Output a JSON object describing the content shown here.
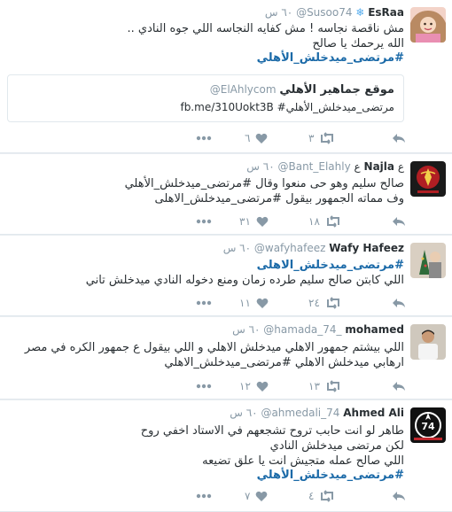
{
  "tweets": [
    {
      "name": "EsRaa",
      "handle": "@Susoo74",
      "time": "٦٠ س",
      "lines": [
        "مش ناقصة نجاسه ! مش كفايه النجاسه اللي جوه النادي ..",
        "الله يرحمك يا صالح"
      ],
      "hashtag": "#مرتضى_ميدخلش_الأهلي",
      "card": {
        "title": "موقع جماهير الأهلي",
        "handle": "@ElAhlycom",
        "text": "fb.me/310Uokt3B #مرتضى_ميدخلش_الأهلي"
      },
      "retweets": "٣",
      "likes": "٦"
    },
    {
      "name": "Najla",
      "handle": "@Bant_Elahly",
      "time": "٦٠ س",
      "lines": [
        "صالح سليم وهو حى منعوا وقال #مرتضى_ميدخلش_الأهلي",
        "وف مماته الجمهور بيقول #مرتضى_ميدخلش_الاهلى"
      ],
      "retweets": "١٨",
      "likes": "٣١"
    },
    {
      "name": "Wafy Hafeez",
      "handle": "@wafyhafeez",
      "time": "٦٠ س",
      "lines": [
        "#مرتضى_ميدخلش_الاهلى",
        "اللي كابتن صالح سليم طرده زمان ومنع دخوله النادي  ميدخلش تاني"
      ],
      "retweets": "٢٤",
      "likes": "١١"
    },
    {
      "name": "mohamed",
      "handle": "@hamada_74_",
      "time": "٦٠ س",
      "lines": [
        "اللي بيشتم جمهور الاهلي ميدخلش الاهلي و اللي بيقول ع جمهور الكره في مصر",
        "ارهابي ميدخلش الاهلي #مرتضى_ميدخلش_الاهلي"
      ],
      "retweets": "١٣",
      "likes": "١٢"
    },
    {
      "name": "Ahmed Ali",
      "handle": "@ahmedali_74",
      "time": "٦٠ س",
      "lines": [
        "طاهر لو انت حابب تروح تشجعهم في الاستاد اخفي روح",
        "لكن مرتضى ميدخلش النادي",
        "اللي صالح عمله متجيش انت يا علق تضيعه"
      ],
      "hashtag": "#مرتضى_ميدخلش_الأهلي",
      "retweets": "٤",
      "likes": "٧"
    }
  ],
  "colors": {
    "hashtag": "#1b6aa8",
    "muted": "#8899a6",
    "text": "#292f33"
  },
  "icons": [
    "reply-icon",
    "retweet-icon",
    "like-icon",
    "more-icon",
    "snowflake-icon",
    "club-logo-icon"
  ]
}
